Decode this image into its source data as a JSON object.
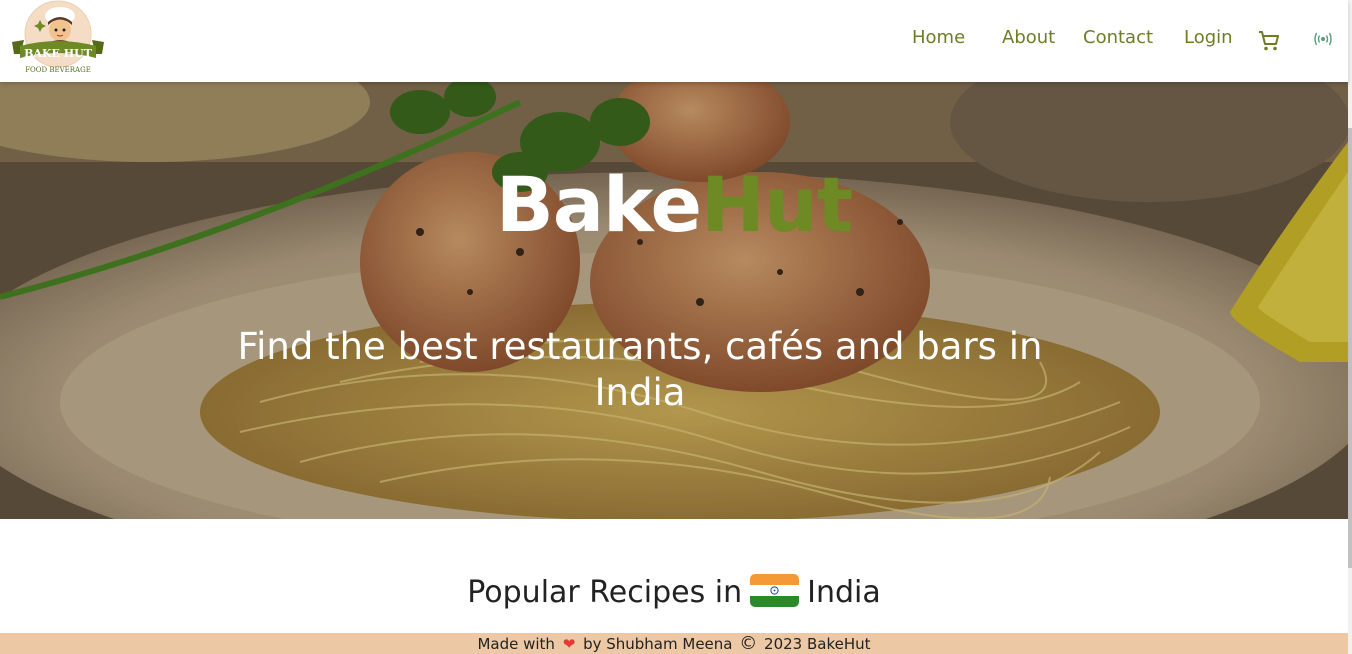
{
  "brand": {
    "logo_line1": "BAKE HUT",
    "logo_line2": "FOOD BEVERAGE"
  },
  "nav": {
    "items": [
      {
        "label": "Home"
      },
      {
        "label": "About"
      },
      {
        "label": "Contact"
      },
      {
        "label": "Login"
      }
    ],
    "cart_icon": "cart-icon",
    "live_icon": "broadcast-icon",
    "color": "#6e7d25"
  },
  "hero": {
    "title_part1": "Bake",
    "title_part2": "Hut",
    "subtitle": "Find the best restaurants, cafés and bars in India",
    "accent_color": "#6e8a25"
  },
  "recipes": {
    "heading_prefix": "Popular Recipes in",
    "heading_country": "India"
  },
  "footer": {
    "made_with": "Made with",
    "by": "by Shubham Meena",
    "copyright": "2023 BakeHut",
    "background": "#ecc9a4"
  }
}
